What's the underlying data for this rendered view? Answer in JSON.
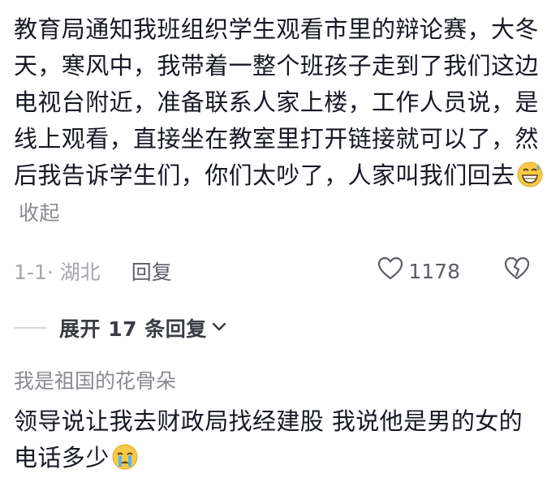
{
  "comments": [
    {
      "text": "教育局通知我班组织学生观看市里的辩论赛，大冬天，寒风中，我带着一整个班孩子走到了我们这边电视台附近，准备联系人家上楼，工作人员说，是线上观看，直接坐在教室里打开链接就可以了，然后我告诉学生们，你们太吵了，人家叫我们回去",
      "emoji": "grinning-sweat-emoji",
      "collapse_label": "收起",
      "time_location": "1-1· 湖北",
      "reply_label": "回复",
      "like_count": "1178",
      "like_icon": "heart-outline-icon",
      "dislike_icon": "broken-heart-icon"
    },
    {
      "username": "我是祖国的花骨朵",
      "text": "领导说让我去财政局找经建股 我说他是男的女的 电话多少",
      "emoji": "crying-emoji"
    }
  ],
  "expand_replies": {
    "label": "展开 17 条回复",
    "icon": "chevron-down-icon"
  }
}
